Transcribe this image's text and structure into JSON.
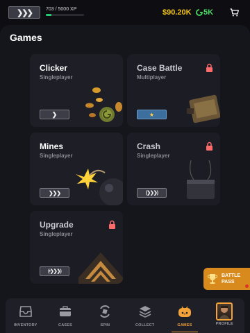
{
  "header": {
    "rank_chevrons": "❯❯❯",
    "xp_text": "703 / 5000 XP",
    "xp_progress": 0.1406,
    "balance": "$90.20K",
    "gems": "5K",
    "colors": {
      "balance": "#f0c419",
      "gems": "#4cd964",
      "xp_fill": "#28c76f"
    }
  },
  "page_title": "Games",
  "games": [
    {
      "title": "Clicker",
      "subtitle": "Singleplayer",
      "locked": false,
      "rank": "❯"
    },
    {
      "title": "Case Battle",
      "subtitle": "Multiplayer",
      "locked": true,
      "rank": "★"
    },
    {
      "title": "Mines",
      "subtitle": "Singleplayer",
      "locked": false,
      "rank": "❯❯❯"
    },
    {
      "title": "Crash",
      "subtitle": "Singleplayer",
      "locked": true,
      "rank": "(❯❯❯)"
    },
    {
      "title": "Upgrade",
      "subtitle": "Singleplayer",
      "locked": true,
      "rank": "(•❯❯❯)"
    }
  ],
  "battle_pass": {
    "line1": "BATTLE",
    "line2": "PASS"
  },
  "nav": {
    "items": [
      {
        "label": "INVENTORY",
        "icon": "inventory-icon"
      },
      {
        "label": "CASES",
        "icon": "cases-icon"
      },
      {
        "label": "SPIN",
        "icon": "spin-icon"
      },
      {
        "label": "COLLECT",
        "icon": "collect-icon"
      },
      {
        "label": "GAMES",
        "icon": "games-icon",
        "active": true
      },
      {
        "label": "PROFILE",
        "icon": "avatar"
      }
    ],
    "accent": "#f3a338"
  }
}
